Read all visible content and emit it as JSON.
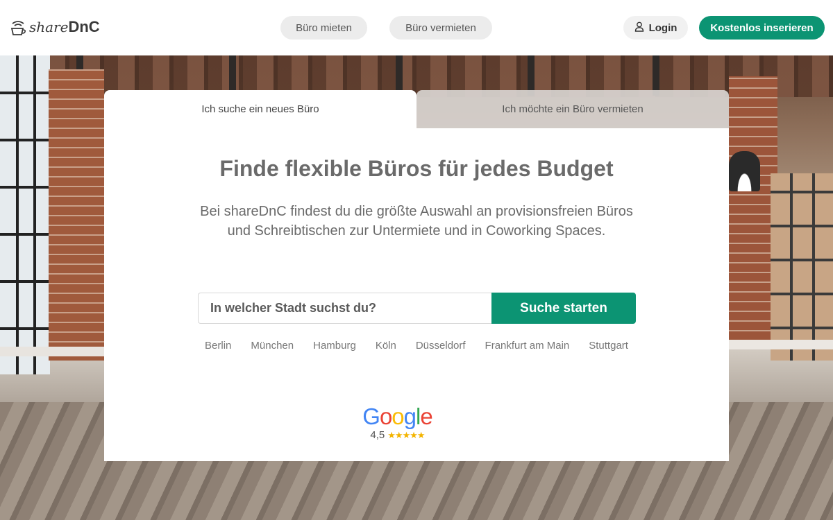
{
  "header": {
    "logo": {
      "share": "share",
      "dnc": "DnC"
    },
    "nav": [
      {
        "label": "Büro mieten"
      },
      {
        "label": "Büro vermieten"
      }
    ],
    "login_label": "Login",
    "cta_label": "Kostenlos inserieren"
  },
  "tabs": [
    {
      "label": "Ich suche ein neues Büro",
      "active": true
    },
    {
      "label": "Ich möchte ein Büro vermieten",
      "active": false
    }
  ],
  "hero": {
    "headline": "Finde flexible Büros für jedes Budget",
    "subtext": "Bei shareDnC findest du die größte Auswahl an provisionsfreien Büros und Schreibtischen zur Untermiete und in Coworking Spaces."
  },
  "search": {
    "placeholder": "In welcher Stadt suchst du?",
    "value": "",
    "button_label": "Suche starten"
  },
  "cities": [
    "Berlin",
    "München",
    "Hamburg",
    "Köln",
    "Düsseldorf",
    "Frankfurt am Main",
    "Stuttgart"
  ],
  "google_rating": {
    "brand": "Google",
    "value": "4,5",
    "stars": "★★★★★",
    "stars_filled": 4.5,
    "stars_max": 5
  },
  "colors": {
    "accent": "#0c9473",
    "tab_underline": "#f1c232",
    "text_muted": "#6a6a6a"
  },
  "icons": {
    "logo": "coffee-cup-wifi-icon",
    "login": "user-icon"
  }
}
